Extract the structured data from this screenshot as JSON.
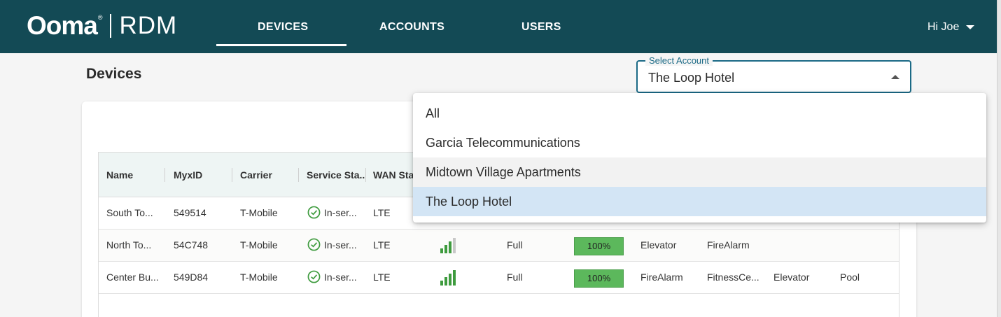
{
  "nav": {
    "logo_main": "Ooma",
    "logo_mark": "®",
    "logo_product": "RDM",
    "tabs": [
      {
        "label": "DEVICES",
        "active": true
      },
      {
        "label": "ACCOUNTS",
        "active": false
      },
      {
        "label": "USERS",
        "active": false
      }
    ],
    "user_greeting": "Hi Joe"
  },
  "page": {
    "title": "Devices"
  },
  "account_select": {
    "label": "Select Account",
    "value": "The Loop Hotel",
    "options": [
      {
        "label": "All",
        "state": "normal"
      },
      {
        "label": "Garcia Telecommunications",
        "state": "normal"
      },
      {
        "label": "Midtown Village Apartments",
        "state": "hover"
      },
      {
        "label": "The Loop Hotel",
        "state": "selected"
      }
    ]
  },
  "table": {
    "columns": [
      "Name",
      "MyxID",
      "Carrier",
      "Service Sta...",
      "WAN Sta"
    ],
    "rows": [
      {
        "name": "South To...",
        "myxid": "549514",
        "carrier": "T-Mobile",
        "status": "In-ser...",
        "wan": "LTE"
      },
      {
        "name": "North To...",
        "myxid": "54C748",
        "carrier": "T-Mobile",
        "status": "In-ser...",
        "wan": "LTE",
        "signal_bars": 3,
        "power": "Full",
        "battery": "100%",
        "tags": [
          "Elevator",
          "FireAlarm"
        ]
      },
      {
        "name": "Center Bu...",
        "myxid": "549D84",
        "carrier": "T-Mobile",
        "status": "In-ser...",
        "wan": "LTE",
        "signal_bars": 4,
        "power": "Full",
        "battery": "100%",
        "tags": [
          "FireAlarm",
          "FitnessCe...",
          "Elevator",
          "Pool"
        ]
      }
    ]
  },
  "colors": {
    "navbar": "#134a55",
    "accent": "#1b6a86",
    "success": "#3e9b3e",
    "battery": "#5cb85c",
    "selected_option": "#d3e5f5"
  }
}
